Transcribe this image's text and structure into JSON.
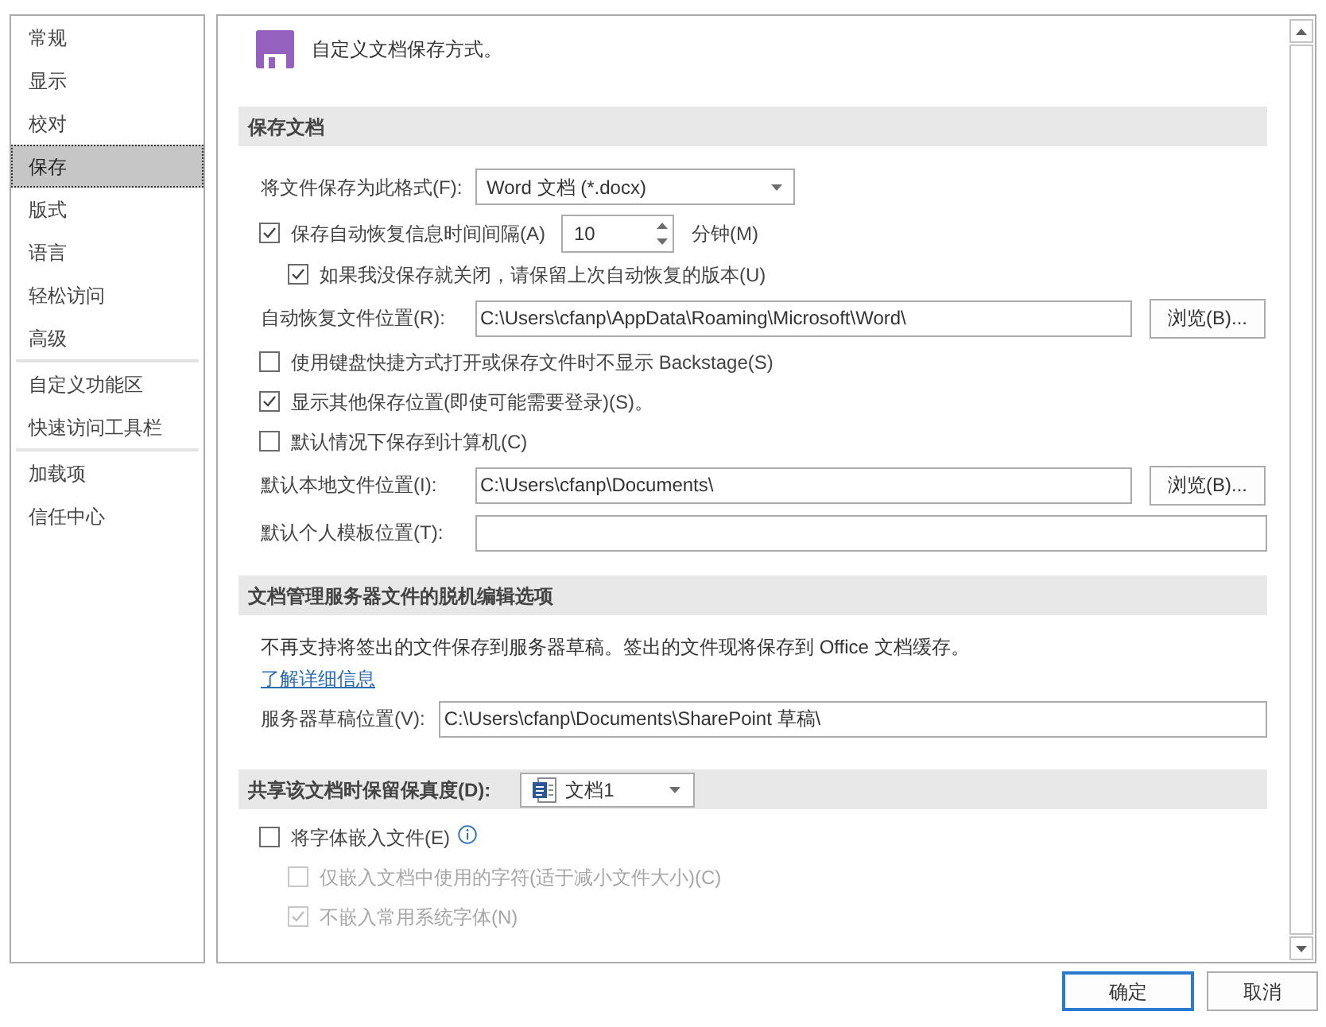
{
  "sidebar": {
    "groups": [
      {
        "items": [
          {
            "label": "常规",
            "selected": false
          },
          {
            "label": "显示",
            "selected": false
          },
          {
            "label": "校对",
            "selected": false
          },
          {
            "label": "保存",
            "selected": true
          },
          {
            "label": "版式",
            "selected": false
          },
          {
            "label": "语言",
            "selected": false
          },
          {
            "label": "轻松访问",
            "selected": false
          },
          {
            "label": "高级",
            "selected": false
          }
        ]
      },
      {
        "items": [
          {
            "label": "自定义功能区",
            "selected": false
          },
          {
            "label": "快速访问工具栏",
            "selected": false
          }
        ]
      },
      {
        "items": [
          {
            "label": "加载项",
            "selected": false
          },
          {
            "label": "信任中心",
            "selected": false
          }
        ]
      }
    ]
  },
  "header": {
    "title": "自定义文档保存方式。"
  },
  "sections": [
    {
      "title": "保存文档",
      "rows": [
        {
          "kind": "select",
          "label": "将文件保存为此格式(F):",
          "value": "Word 文档 (*.docx)"
        },
        {
          "kind": "checkbox",
          "label": "保存自动恢复信息时间间隔(A)",
          "checked": true,
          "disabled": false,
          "spinner": {
            "value": "10",
            "unit": "分钟(M)"
          },
          "children": [
            {
              "kind": "checkbox",
              "label": "如果我没保存就关闭，请保留上次自动恢复的版本(U)",
              "checked": true,
              "disabled": false
            }
          ]
        },
        {
          "kind": "path",
          "label": "自动恢复文件位置(R):",
          "value": "C:\\Users\\cfanp\\AppData\\Roaming\\Microsoft\\Word\\",
          "button": "浏览(B)..."
        },
        {
          "kind": "checkbox",
          "label": "使用键盘快捷方式打开或保存文件时不显示 Backstage(S)",
          "checked": false,
          "disabled": false
        },
        {
          "kind": "checkbox",
          "label": "显示其他保存位置(即使可能需要登录)(S)。",
          "checked": true,
          "disabled": false
        },
        {
          "kind": "checkbox",
          "label": "默认情况下保存到计算机(C)",
          "checked": false,
          "disabled": false
        },
        {
          "kind": "path",
          "label": "默认本地文件位置(I):",
          "value": "C:\\Users\\cfanp\\Documents\\",
          "button": "浏览(B)..."
        },
        {
          "kind": "path",
          "label": "默认个人模板位置(T):"
        }
      ]
    },
    {
      "title": "文档管理服务器文件的脱机编辑选项",
      "rows": [
        {
          "kind": "text",
          "text": "不再支持将签出的文件保存到服务器草稿。签出的文件现将保存到 Office 文档缓存。"
        },
        {
          "kind": "link",
          "text": "了解详细信息"
        },
        {
          "kind": "path",
          "label": "服务器草稿位置(V):",
          "value": "C:\\Users\\cfanp\\Documents\\SharePoint 草稿\\"
        }
      ]
    },
    {
      "title": "共享该文档时保留保真度(D):",
      "select": {
        "value": "文档1"
      },
      "rows": [
        {
          "kind": "checkbox",
          "label": "将字体嵌入文件(E)",
          "checked": false,
          "disabled": false,
          "info": true,
          "children": [
            {
              "kind": "checkbox",
              "label": "仅嵌入文档中使用的字符(适于减小文件大小)(C)",
              "checked": false,
              "disabled": true
            },
            {
              "kind": "checkbox",
              "label": "不嵌入常用系统字体(N)",
              "checked": true,
              "disabled": true
            }
          ]
        }
      ]
    }
  ],
  "buttons": [
    {
      "label": "确定",
      "default": true
    },
    {
      "label": "取消",
      "default": false
    }
  ]
}
